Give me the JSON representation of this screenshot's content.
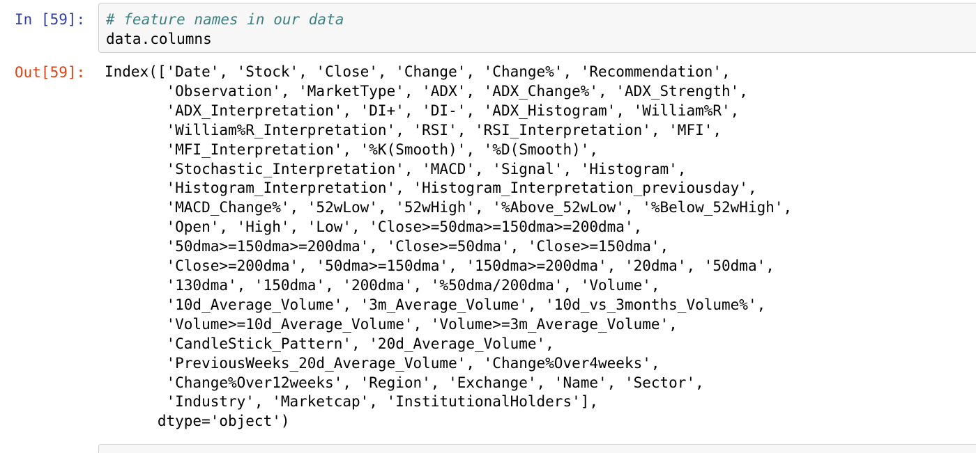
{
  "cell_in": {
    "prompt": "In [59]:",
    "comment": "# feature names in our data",
    "code": "data.columns"
  },
  "cell_out": {
    "prompt": "Out[59]:",
    "text": "Index(['Date', 'Stock', 'Close', 'Change', 'Change%', 'Recommendation',\n       'Observation', 'MarketType', 'ADX', 'ADX_Change%', 'ADX_Strength',\n       'ADX_Interpretation', 'DI+', 'DI-', 'ADX_Histogram', 'William%R',\n       'William%R_Interpretation', 'RSI', 'RSI_Interpretation', 'MFI',\n       'MFI_Interpretation', '%K(Smooth)', '%D(Smooth)',\n       'Stochastic_Interpretation', 'MACD', 'Signal', 'Histogram',\n       'Histogram_Interpretation', 'Histogram_Interpretation_previousday',\n       'MACD_Change%', '52wLow', '52wHigh', '%Above_52wLow', '%Below_52wHigh',\n       'Open', 'High', 'Low', 'Close>=50dma>=150dma>=200dma',\n       '50dma>=150dma>=200dma', 'Close>=50dma', 'Close>=150dma',\n       'Close>=200dma', '50dma>=150dma', '150dma>=200dma', '20dma', '50dma',\n       '130dma', '150dma', '200dma', '%50dma/200dma', 'Volume',\n       '10d_Average_Volume', '3m_Average_Volume', '10d_vs_3months_Volume%',\n       'Volume>=10d_Average_Volume', 'Volume>=3m_Average_Volume',\n       'CandleStick_Pattern', '20d_Average_Volume',\n       'PreviousWeeks_20d_Average_Volume', 'Change%Over4weeks',\n       'Change%Over12weeks', 'Region', 'Exchange', 'Name', 'Sector',\n       'Industry', 'Marketcap', 'InstitutionalHolders'],\n      dtype='object')"
  },
  "colors": {
    "in_prompt": "#303F9F",
    "out_prompt": "#D84315",
    "comment": "#408080",
    "input_background": "#f7f7f7",
    "input_border": "#cfcfcf"
  }
}
